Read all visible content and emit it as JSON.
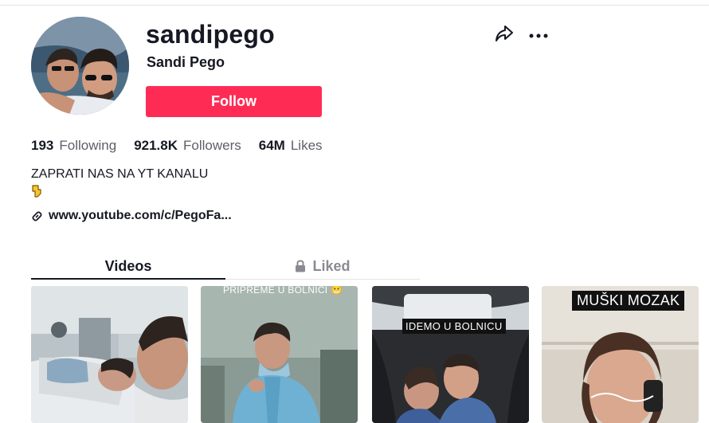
{
  "profile": {
    "username": "sandipego",
    "display_name": "Sandi Pego",
    "follow_label": "Follow"
  },
  "stats": [
    {
      "value": "193",
      "label": "Following"
    },
    {
      "value": "921.8K",
      "label": "Followers"
    },
    {
      "value": "64M",
      "label": "Likes"
    }
  ],
  "bio": {
    "text": "ZAPRATI NAS NA YT KANALU",
    "emoji": "👇",
    "link": "www.youtube.com/c/PegoFa..."
  },
  "tabs": [
    {
      "label": "Videos",
      "active": true
    },
    {
      "label": "Liked",
      "locked": true
    }
  ],
  "videos": [
    {
      "caption": ""
    },
    {
      "caption": "PRIPREME U BOLNICI 😬"
    },
    {
      "caption": "IDEMO U BOLNICU"
    },
    {
      "caption": "MUŠKI MOZAK"
    }
  ],
  "colors": {
    "accent": "#fe2c55",
    "text": "#161823",
    "muted": "#5e6068",
    "tab_inactive": "#8a8b91"
  },
  "icons": {
    "share": "share-arrow-icon",
    "more": "more-dots-icon",
    "link": "link-icon",
    "lock": "lock-icon"
  }
}
